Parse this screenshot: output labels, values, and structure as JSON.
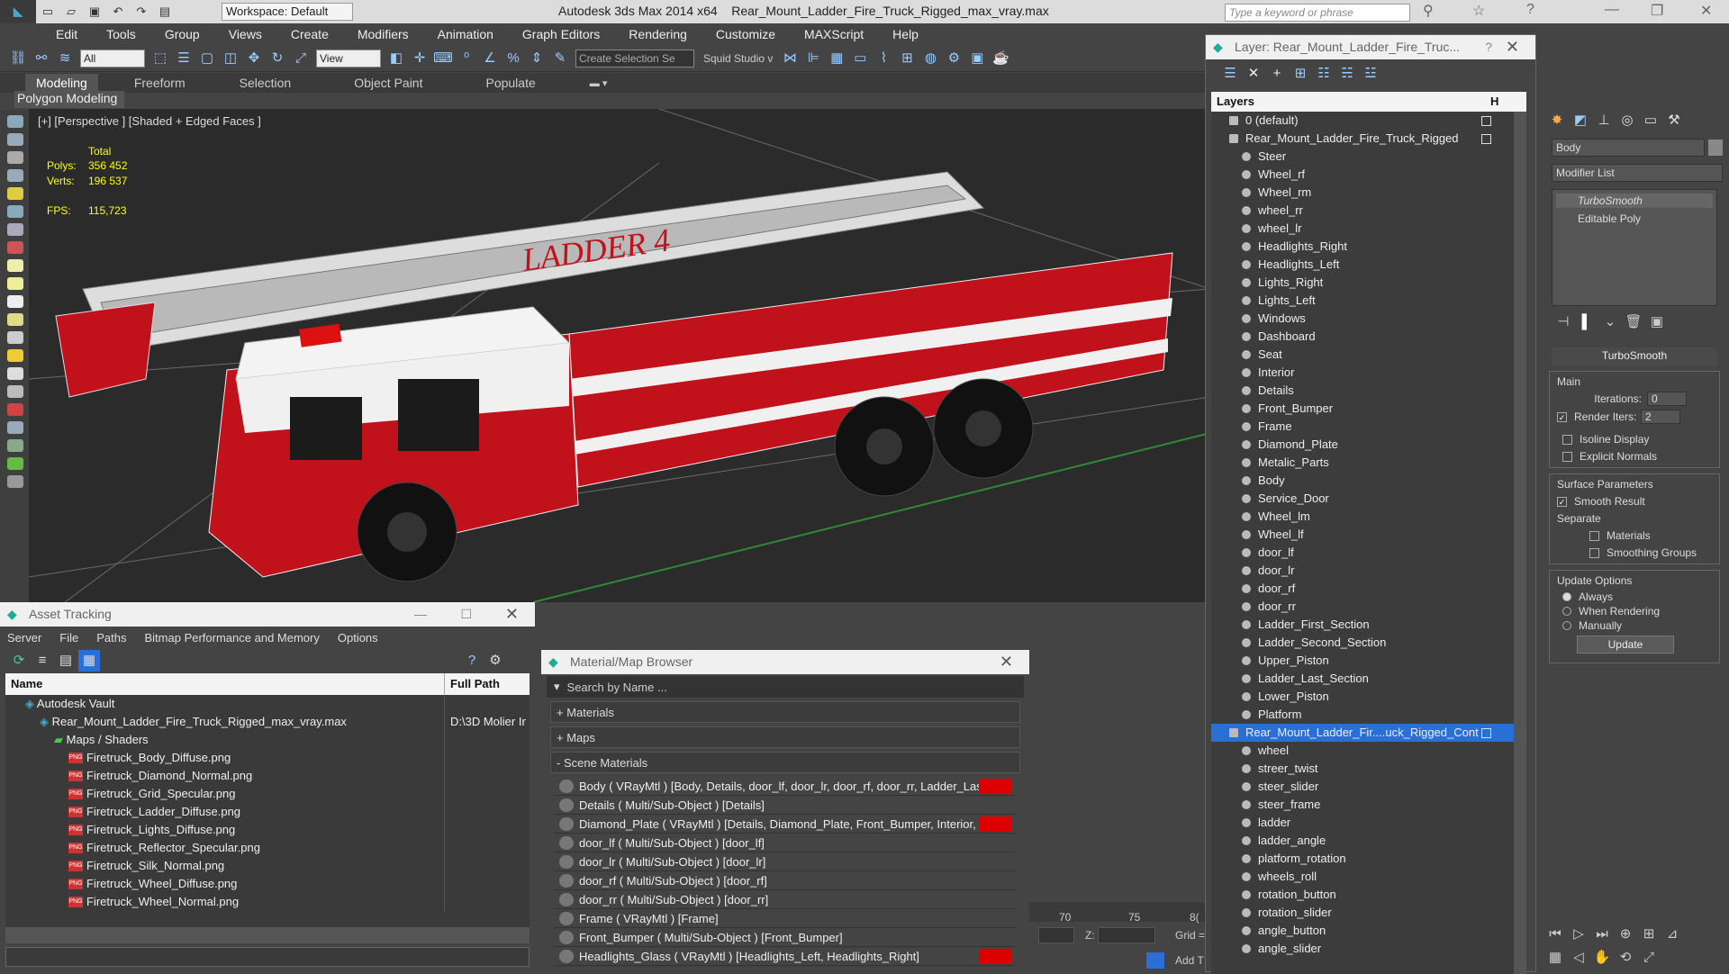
{
  "app": {
    "title": "Autodesk 3ds Max  2014 x64",
    "file": "Rear_Mount_Ladder_Fire_Truck_Rigged_max_vray.max",
    "workspace": "Workspace: Default",
    "search_placeholder": "Type a keyword or phrase"
  },
  "menu": [
    "Edit",
    "Tools",
    "Group",
    "Views",
    "Create",
    "Modifiers",
    "Animation",
    "Graph Editors",
    "Rendering",
    "Customize",
    "MAXScript",
    "Help"
  ],
  "toolbar": {
    "filter": "All",
    "view": "View",
    "selection_set": "Create Selection Se",
    "squid": "Squid Studio v"
  },
  "ribbon": {
    "tabs": [
      "Modeling",
      "Freeform",
      "Selection",
      "Object Paint",
      "Populate"
    ],
    "panel": "Polygon Modeling"
  },
  "viewport": {
    "label": "[+] [Perspective ] [Shaded + Edged Faces ]",
    "total": "Total",
    "polys_label": "Polys:",
    "polys": "356 452",
    "verts_label": "Verts:",
    "verts": "196 537",
    "fps_label": "FPS:",
    "fps": "115,723",
    "truck_text": "LADDER 4"
  },
  "asset": {
    "title": "Asset Tracking",
    "menu": [
      "Server",
      "File",
      "Paths",
      "Bitmap Performance and Memory",
      "Options"
    ],
    "col_name": "Name",
    "col_path": "Full Path",
    "rows": [
      {
        "name": "Autodesk Vault",
        "path": "",
        "indent": 1
      },
      {
        "name": "Rear_Mount_Ladder_Fire_Truck_Rigged_max_vray.max",
        "path": "D:\\3D Molier In",
        "indent": 2
      },
      {
        "name": "Maps / Shaders",
        "path": "",
        "indent": 3
      },
      {
        "name": "Firetruck_Body_Diffuse.png",
        "path": "",
        "indent": 4
      },
      {
        "name": "Firetruck_Diamond_Normal.png",
        "path": "",
        "indent": 4
      },
      {
        "name": "Firetruck_Grid_Specular.png",
        "path": "",
        "indent": 4
      },
      {
        "name": "Firetruck_Ladder_Diffuse.png",
        "path": "",
        "indent": 4
      },
      {
        "name": "Firetruck_Lights_Diffuse.png",
        "path": "",
        "indent": 4
      },
      {
        "name": "Firetruck_Reflector_Specular.png",
        "path": "",
        "indent": 4
      },
      {
        "name": "Firetruck_Silk_Normal.png",
        "path": "",
        "indent": 4
      },
      {
        "name": "Firetruck_Wheel_Diffuse.png",
        "path": "",
        "indent": 4
      },
      {
        "name": "Firetruck_Wheel_Normal.png",
        "path": "",
        "indent": 4
      }
    ]
  },
  "material": {
    "title": "Material/Map Browser",
    "search": "Search by Name ...",
    "sections": [
      "+ Materials",
      "+ Maps",
      "- Scene Materials"
    ],
    "rows": [
      {
        "text": "Body  ( VRayMtl ) [Body, Details, door_lf, door_lr, door_rf, door_rr, Ladder_Last...",
        "flag": true
      },
      {
        "text": "Details  ( Multi/Sub-Object ) [Details]",
        "flag": false
      },
      {
        "text": "Diamond_Plate  ( VRayMtl ) [Details, Diamond_Plate, Front_Bumper, Interior, Pl...",
        "flag": true
      },
      {
        "text": "door_lf  ( Multi/Sub-Object ) [door_lf]",
        "flag": false
      },
      {
        "text": "door_lr  ( Multi/Sub-Object ) [door_lr]",
        "flag": false
      },
      {
        "text": "door_rf  ( Multi/Sub-Object ) [door_rf]",
        "flag": false
      },
      {
        "text": "door_rr  ( Multi/Sub-Object ) [door_rr]",
        "flag": false
      },
      {
        "text": "Frame  ( VRayMtl ) [Frame]",
        "flag": false
      },
      {
        "text": "Front_Bumper  ( Multi/Sub-Object ) [Front_Bumper]",
        "flag": false
      },
      {
        "text": "Headlights_Glass ( VRayMtl ) [Headlights_Left, Headlights_Right]",
        "flag": true
      }
    ]
  },
  "layers": {
    "title": "Layer: Rear_Mount_Ladder_Fire_Truc...",
    "header": "Layers",
    "hide_col": "H",
    "rows": [
      {
        "name": "0 (default)",
        "top": true
      },
      {
        "name": "Rear_Mount_Ladder_Fire_Truck_Rigged",
        "top": true
      },
      {
        "name": "Steer"
      },
      {
        "name": "Wheel_rf"
      },
      {
        "name": "Wheel_rm"
      },
      {
        "name": "wheel_rr"
      },
      {
        "name": "wheel_lr"
      },
      {
        "name": "Headlights_Right"
      },
      {
        "name": "Headlights_Left"
      },
      {
        "name": "Lights_Right"
      },
      {
        "name": "Lights_Left"
      },
      {
        "name": "Windows"
      },
      {
        "name": "Dashboard"
      },
      {
        "name": "Seat"
      },
      {
        "name": "Interior"
      },
      {
        "name": "Details"
      },
      {
        "name": "Front_Bumper"
      },
      {
        "name": "Frame"
      },
      {
        "name": "Diamond_Plate"
      },
      {
        "name": "Metalic_Parts"
      },
      {
        "name": "Body"
      },
      {
        "name": "Service_Door"
      },
      {
        "name": "Wheel_lm"
      },
      {
        "name": "Wheel_lf"
      },
      {
        "name": "door_lf"
      },
      {
        "name": "door_lr"
      },
      {
        "name": "door_rf"
      },
      {
        "name": "door_rr"
      },
      {
        "name": "Ladder_First_Section"
      },
      {
        "name": "Ladder_Second_Section"
      },
      {
        "name": "Upper_Piston"
      },
      {
        "name": "Ladder_Last_Section"
      },
      {
        "name": "Lower_Piston"
      },
      {
        "name": "Platform"
      },
      {
        "name": "Rear_Mount_Ladder_Fir....uck_Rigged_Cont",
        "top": true,
        "sel": true
      },
      {
        "name": "wheel"
      },
      {
        "name": "streer_twist"
      },
      {
        "name": "steer_slider"
      },
      {
        "name": "steer_frame"
      },
      {
        "name": "ladder"
      },
      {
        "name": "ladder_angle"
      },
      {
        "name": "platform_rotation"
      },
      {
        "name": "wheels_roll"
      },
      {
        "name": "rotation_button"
      },
      {
        "name": "rotation_slider"
      },
      {
        "name": "angle_button"
      },
      {
        "name": "angle_slider"
      }
    ]
  },
  "command": {
    "object_name": "Body",
    "modifier_list": "Modifier List",
    "stack": [
      "TurboSmooth",
      "Editable Poly"
    ],
    "rollout": "TurboSmooth",
    "main": "Main",
    "iterations_label": "Iterations:",
    "iterations": "0",
    "render_iters_label": "Render Iters:",
    "render_iters": "2",
    "isoline": "Isoline Display",
    "explicit": "Explicit Normals",
    "surface": "Surface Parameters",
    "smooth": "Smooth Result",
    "separate": "Separate",
    "materials": "Materials",
    "smoothing": "Smoothing Groups",
    "update_opts": "Update Options",
    "always": "Always",
    "when_rendering": "When Rendering",
    "manually": "Manually",
    "update_btn": "Update"
  },
  "timeline": {
    "ticks": [
      "70",
      "75",
      "8("
    ],
    "z_label": "Z:",
    "grid": "Grid =",
    "addt": "Add T"
  }
}
